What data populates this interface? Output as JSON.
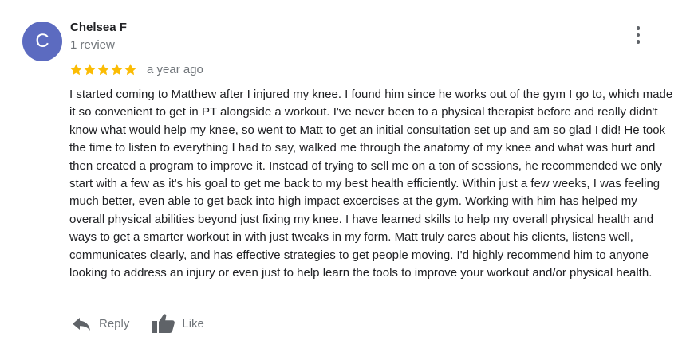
{
  "review": {
    "avatar_letter": "C",
    "avatar_color": "#5c6bc0",
    "author_name": "Chelsea F",
    "review_count": "1 review",
    "rating": 5,
    "max_rating": 5,
    "star_color": "#fbbc04",
    "date": "a year ago",
    "text": "I started coming to Matthew after I injured my knee. I found him since he works out of the gym I go to, which made it so convenient to get in PT alongside a workout. I've never been to a physical therapist before and really didn't know what would help my knee, so went to Matt to get an initial consultation set up and am so glad I did! He took the time to listen to everything I had to say, walked me through the anatomy of my knee and what was hurt and then created a program to improve it. Instead of trying to sell me on a ton of sessions, he recommended we only start with a few as it's his goal to get me back to my best health efficiently. Within just a few weeks, I was feeling much better, even able to get back into high impact excercises at the gym. Working with him has helped my overall physical abilities beyond just fixing my knee. I have learned skills to help my overall physical health and ways to get a smarter workout in with just tweaks in my form. Matt truly cares about his clients, listens well, communicates clearly, and has effective strategies to get people moving. I'd highly recommend him to anyone looking to address an injury or even just to help learn the tools to improve your workout and/or physical health."
  },
  "actions": {
    "reply_label": "Reply",
    "reply_icon": "reply-icon",
    "like_label": "Like",
    "like_icon": "thumbs-up-icon"
  },
  "menu": {
    "icon": "more-vert-icon"
  }
}
